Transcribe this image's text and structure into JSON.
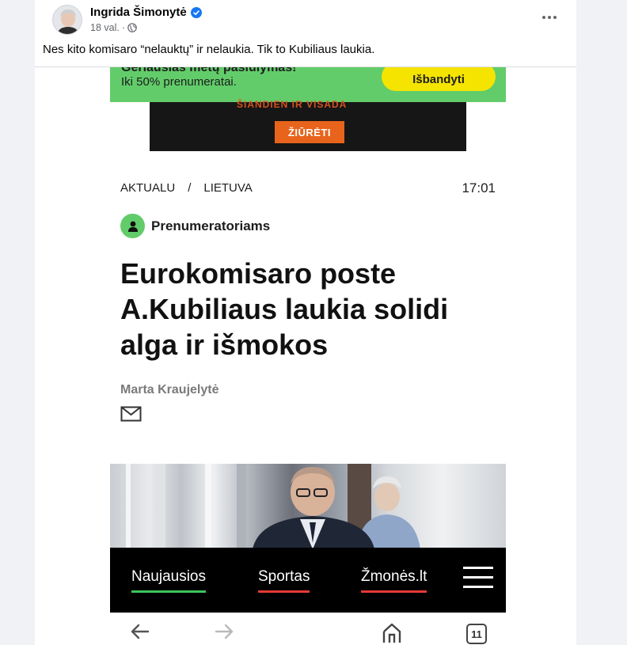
{
  "post": {
    "author": "Ingrida Šimonytė",
    "time": "18 val.",
    "text": "Nes kito komisaro “nelauktų” ir nelaukia. Tik to Kubiliaus laukia."
  },
  "screenshot": {
    "promo": {
      "top_text": "Geriausias metų pasiūlymas!",
      "sub_text": "Iki 50% prenumeratai.",
      "button": "Išbandyti",
      "color": "#62cc6a",
      "button_color": "#f5e400"
    },
    "video_ad": {
      "top_text": "ŠIANDIEN IR VISADA",
      "button": "ŽIŪRĖTI"
    },
    "breadcrumb": {
      "section": "AKTUALU",
      "separator": "/",
      "subsection": "LIETUVA"
    },
    "time": "17:01",
    "badge": "Prenumeratoriams",
    "headline": "Eurokomisaro poste A.Kubiliaus laukia solidi alga ir išmokos",
    "author": "Marta Kraujelytė",
    "nav": [
      {
        "label": "Naujausios",
        "underline_color": "#3cc45a"
      },
      {
        "label": "Sportas",
        "underline_color": "#e53935"
      },
      {
        "label": "Žmonės.lt",
        "underline_color": "#e53935"
      }
    ],
    "browser": {
      "tab_count": "11"
    },
    "icons": [
      "back-arrow-icon",
      "forward-arrow-icon",
      "home-icon",
      "tabs-icon",
      "hamburger-menu-icon",
      "mail-icon",
      "user-icon"
    ]
  }
}
